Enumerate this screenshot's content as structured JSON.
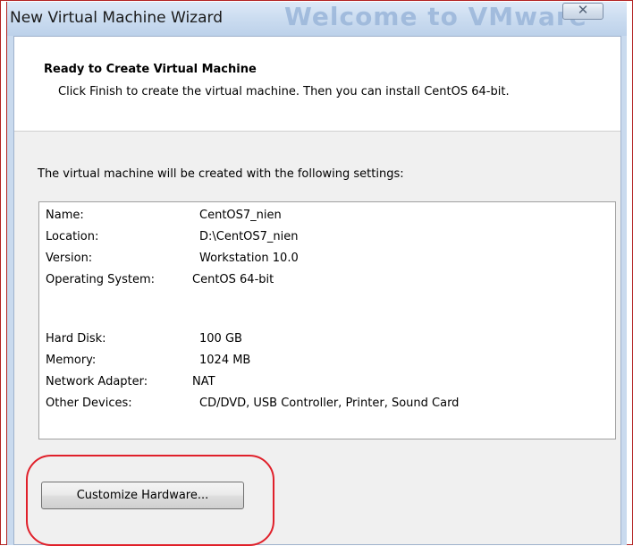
{
  "window": {
    "title": "New Virtual Machine Wizard",
    "background_title": "Welcome to VMware",
    "close_icon": "close-icon"
  },
  "header": {
    "title": "Ready to Create Virtual Machine",
    "description": "Click Finish to create the virtual machine. Then you can install CentOS 64-bit."
  },
  "settings": {
    "intro": "The virtual machine will be created with the following settings:",
    "rows": [
      {
        "label": "Name:",
        "value": "CentOS7_nien"
      },
      {
        "label": "Location:",
        "value": "D:\\CentOS7_nien"
      },
      {
        "label": "Version:",
        "value": "Workstation 10.0"
      },
      {
        "label": "Operating System:",
        "value": "CentOS 64-bit"
      },
      {
        "label": "Hard Disk:",
        "value": "100 GB"
      },
      {
        "label": "Memory:",
        "value": "1024 MB"
      },
      {
        "label": "Network Adapter:",
        "value": "NAT"
      },
      {
        "label": "Other Devices:",
        "value": "CD/DVD, USB Controller, Printer, Sound Card"
      }
    ]
  },
  "buttons": {
    "customize_hardware": "Customize Hardware..."
  },
  "colors": {
    "annotation_ring": "#e0202a",
    "window_frame": "#c9daee",
    "dialog_face": "#f0f0f0"
  }
}
